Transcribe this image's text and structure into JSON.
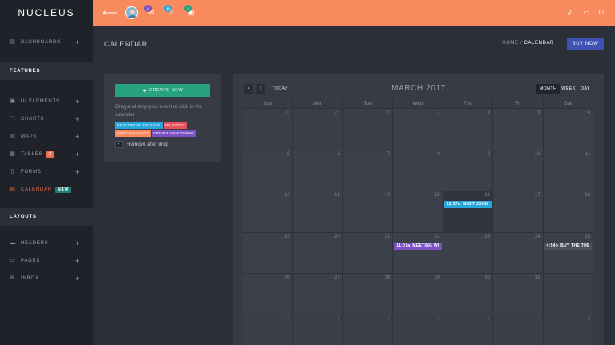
{
  "brand": "NUCLEUS",
  "sidebar": {
    "dashboards": "DASHBOARDS",
    "features_heading": "FEATURES",
    "features": [
      {
        "label": "UI ELEMENTS",
        "icon": "ui-elements-icon"
      },
      {
        "label": "CHARTS",
        "icon": "chart-line-icon"
      },
      {
        "label": "MAPS",
        "icon": "map-icon"
      },
      {
        "label": "TABLES",
        "icon": "table-icon",
        "badge": "2"
      },
      {
        "label": "FORMS",
        "icon": "form-icon"
      },
      {
        "label": "CALENDAR",
        "icon": "calendar-icon",
        "badge": "NEW"
      }
    ],
    "layouts_heading": "LAYOUTS",
    "layouts": [
      {
        "label": "HEADERS",
        "icon": "header-icon"
      },
      {
        "label": "PAGES",
        "icon": "pages-icon"
      },
      {
        "label": "INBOX",
        "icon": "inbox-icon"
      }
    ]
  },
  "topbar": {
    "badges": [
      {
        "count": "8",
        "color": "#7b52c4",
        "icon": "mail-icon"
      },
      {
        "count": "10",
        "color": "#2aa6db",
        "icon": "bell-icon"
      },
      {
        "count": "3",
        "color": "#26a37c",
        "icon": "clipboard-icon"
      }
    ],
    "right_icons": [
      "search-icon",
      "chat-icon",
      "power-icon"
    ]
  },
  "page": {
    "title": "CALENDAR",
    "breadcrumb_home": "HOME",
    "breadcrumb_sep": "/",
    "breadcrumb_current": "CALENDAR",
    "buy_label": "BUY NOW"
  },
  "events_panel": {
    "create_label": "CREATE NEW",
    "drag_text": "Drag and drop your event or click in the calendar",
    "tags": [
      {
        "label": "NEW THEME RELEASE",
        "color": "#2aa6db"
      },
      {
        "label": "MY EVENT",
        "color": "#e8505b"
      },
      {
        "label": "MEET MANAGER",
        "color": "#f98a5e"
      },
      {
        "label": "CREATE NEW THEME",
        "color": "#7b52c4"
      }
    ],
    "remove_label": "Remove after drop"
  },
  "calendar": {
    "title": "MARCH 2017",
    "today_label": "TODAY",
    "views": [
      "MONTH",
      "WEEK",
      "DAY"
    ],
    "active_view": "MONTH",
    "weekdays": [
      "Sun",
      "Mon",
      "Tue",
      "Wed",
      "Thu",
      "Fri",
      "Sat"
    ],
    "weeks": [
      [
        {
          "d": "26",
          "o": true
        },
        {
          "d": "27",
          "o": true
        },
        {
          "d": "28",
          "o": true
        },
        {
          "d": "1"
        },
        {
          "d": "2"
        },
        {
          "d": "3"
        },
        {
          "d": "4"
        }
      ],
      [
        {
          "d": "5"
        },
        {
          "d": "6"
        },
        {
          "d": "7"
        },
        {
          "d": "8"
        },
        {
          "d": "9"
        },
        {
          "d": "10"
        },
        {
          "d": "11"
        }
      ],
      [
        {
          "d": "12"
        },
        {
          "d": "13"
        },
        {
          "d": "14"
        },
        {
          "d": "15"
        },
        {
          "d": "16",
          "today": true,
          "event": {
            "time": "12:07a",
            "title": "MEET JOHN",
            "color": "#2aa6db"
          }
        },
        {
          "d": "17"
        },
        {
          "d": "18"
        }
      ],
      [
        {
          "d": "19"
        },
        {
          "d": "20"
        },
        {
          "d": "21"
        },
        {
          "d": "22",
          "event": {
            "time": "11:07a",
            "title": "MEETING WI",
            "color": "#7b52c4"
          }
        },
        {
          "d": "23"
        },
        {
          "d": "24"
        },
        {
          "d": "25",
          "event": {
            "time": "4:54p",
            "title": "BUY THE THE",
            "color": "#4a505b"
          }
        }
      ],
      [
        {
          "d": "26"
        },
        {
          "d": "27"
        },
        {
          "d": "28"
        },
        {
          "d": "29"
        },
        {
          "d": "30"
        },
        {
          "d": "31"
        },
        {
          "d": "1",
          "o": true
        }
      ],
      [
        {
          "d": "2",
          "o": true
        },
        {
          "d": "3",
          "o": true
        },
        {
          "d": "4",
          "o": true
        },
        {
          "d": "5",
          "o": true
        },
        {
          "d": "6",
          "o": true
        },
        {
          "d": "7",
          "o": true
        },
        {
          "d": "8",
          "o": true
        }
      ]
    ]
  }
}
